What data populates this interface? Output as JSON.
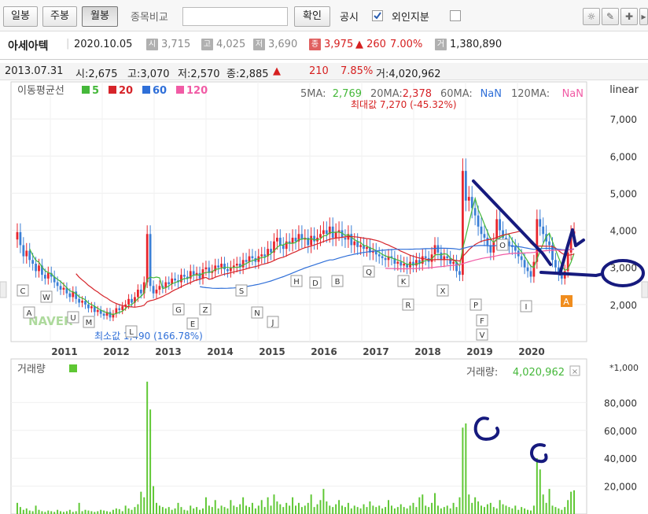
{
  "toolbar": {
    "daily": "일봉",
    "weekly": "주봉",
    "monthly": "월봉",
    "compare_label": "종목비교",
    "compare_value": "",
    "confirm": "확인",
    "disclosure": "공시",
    "foreign": "외인지분",
    "disclosure_checked": true,
    "foreign_checked": false
  },
  "quote": {
    "name": "아세아텍",
    "date": "2020.10.05",
    "open_label": "시",
    "open": "3,715",
    "high_label": "고",
    "high": "4,025",
    "low_label": "저",
    "low": "3,690",
    "close_label": "종",
    "close": "3,975",
    "change": "▲ 260",
    "change_pct": "7.00%",
    "vol_label": "거",
    "volume": "1,380,890"
  },
  "info": {
    "date": "2013.07.31",
    "open": "시:2,675",
    "high": "고:3,070",
    "low": "저:2,570",
    "close": "종:2,885",
    "arrow": "▲",
    "change": "210",
    "change_pct": "7.85%",
    "volume": "거:4,020,962"
  },
  "colors": {
    "up": "#e8242b",
    "down": "#3a7fd6",
    "ma5": "#45b83a",
    "ma20": "#d6242a",
    "ma60": "#2f6fd8",
    "ma120": "#f15ba5",
    "volume": "#5ec733",
    "annotation": "#161a7e"
  },
  "chart_data": {
    "type": "candlestick",
    "scale": "linear",
    "title_label": "이동평균선",
    "ma_legend": [
      {
        "period": "5",
        "color": "#45b83a"
      },
      {
        "period": "20",
        "color": "#d6242a"
      },
      {
        "period": "60",
        "color": "#2f6fd8"
      },
      {
        "period": "120",
        "color": "#f15ba5"
      }
    ],
    "ma_values": [
      {
        "label": "5MA:",
        "value": "2,769",
        "color": "#45b83a"
      },
      {
        "label": "20MA:",
        "value": "2,378",
        "color": "#d6242a"
      },
      {
        "label": "60MA:",
        "value": "NaN",
        "color": "#2f6fd8"
      },
      {
        "label": "120MA:",
        "value": "NaN",
        "color": "#f15ba5"
      }
    ],
    "max_label": "최대값 7,270 (-45.32%)",
    "min_label": "최소값 1,490 (166.78%)",
    "ylim": [
      1000,
      8000
    ],
    "yticks": [
      2000,
      3000,
      4000,
      5000,
      6000,
      7000
    ],
    "ytick_labels": [
      "2,000",
      "3,000",
      "4,000",
      "5,000",
      "6,000",
      "7,000"
    ],
    "xticks": [
      "2011",
      "2012",
      "2013",
      "2014",
      "2015",
      "2016",
      "2017",
      "2018",
      "2019",
      "2020"
    ],
    "closes": [
      3950,
      3600,
      3300,
      3450,
      3200,
      3100,
      2900,
      3050,
      2800,
      2700,
      2850,
      2750,
      2600,
      2500,
      2400,
      2450,
      2300,
      2200,
      2350,
      2150,
      2050,
      2100,
      2000,
      1900,
      1950,
      1800,
      1850,
      1750,
      1700,
      1800,
      1650,
      1750,
      1900,
      1850,
      1950,
      2000,
      2150,
      2050,
      2200,
      2400,
      2300,
      2600,
      3900,
      2500,
      2300,
      2400,
      2500,
      2450,
      2600,
      2550,
      2700,
      2650,
      2600,
      2800,
      2750,
      2700,
      2900,
      2800,
      2850,
      2700,
      2950,
      3000,
      2850,
      2900,
      3050,
      3000,
      3100,
      2950,
      2900,
      3000,
      3050,
      3100,
      3000,
      3200,
      3150,
      3300,
      3250,
      3150,
      3300,
      3350,
      3300,
      3500,
      3400,
      3700,
      3800,
      3600,
      3500,
      3700,
      3650,
      3800,
      3700,
      3900,
      3750,
      3800,
      3600,
      3850,
      3700,
      3800,
      3900,
      4000,
      3900,
      4100,
      3800,
      3950,
      4000,
      3800,
      3750,
      3900,
      3600,
      3700,
      3550,
      3600,
      3500,
      3550,
      3400,
      3450,
      3350,
      3300,
      3250,
      3200,
      3300,
      3250,
      3100,
      3150,
      3050,
      3100,
      3000,
      3150,
      3050,
      3200,
      3100,
      3300,
      3250,
      3150,
      3350,
      3600,
      3400,
      3200,
      3300,
      3250,
      3100,
      3150,
      2900,
      2800,
      5600,
      4800,
      4900,
      4600,
      4400,
      4100,
      3900,
      3800,
      3600,
      3400,
      3700,
      4300,
      4000,
      3800,
      3700,
      3600,
      3550,
      3450,
      3300,
      3200,
      3000,
      2900,
      2750,
      3150,
      4300,
      4100,
      3900,
      3700,
      3600,
      3200,
      3000,
      2800,
      2700,
      2900,
      3400,
      3900,
      3975
    ],
    "volume_ylim": [
      0,
      100000
    ],
    "volume_unit": "*1,000",
    "volume_label": "거래량",
    "volume_value_label": "거래량:",
    "volume_value": "4,020,962",
    "volume_yticks": [
      "20,000",
      "40,000",
      "60,000",
      "80,000"
    ],
    "volume": [
      8000,
      5000,
      3000,
      4000,
      2500,
      2000,
      6000,
      3000,
      2000,
      1500,
      2500,
      2000,
      1500,
      3000,
      2000,
      1500,
      2000,
      3000,
      1500,
      2000,
      8000,
      2000,
      3000,
      2500,
      2000,
      1500,
      2000,
      3000,
      2500,
      2000,
      1500,
      3000,
      4000,
      3500,
      2000,
      6000,
      4000,
      3000,
      5000,
      7000,
      16000,
      12000,
      95000,
      75000,
      20000,
      8000,
      6000,
      5000,
      4000,
      5000,
      3000,
      4000,
      8000,
      5000,
      3000,
      2500,
      6000,
      4000,
      5000,
      3000,
      4000,
      12000,
      6000,
      5000,
      10000,
      4000,
      6000,
      5000,
      4000,
      10000,
      6000,
      5000,
      7000,
      12000,
      6000,
      5000,
      8000,
      4000,
      6000,
      10000,
      5000,
      12000,
      6000,
      14000,
      9000,
      7000,
      5000,
      8000,
      6000,
      12000,
      6000,
      8000,
      5000,
      6000,
      8000,
      14000,
      5000,
      7000,
      10000,
      18000,
      9000,
      6000,
      5000,
      7000,
      10000,
      6000,
      5000,
      8000,
      4000,
      6000,
      5000,
      4000,
      7000,
      5000,
      9000,
      6000,
      5000,
      6000,
      4000,
      5000,
      10000,
      6000,
      4000,
      5000,
      7000,
      5000,
      4000,
      6000,
      8000,
      5000,
      12000,
      14000,
      6000,
      5000,
      8000,
      15000,
      6000,
      4000,
      5000,
      6000,
      4000,
      8000,
      5000,
      12000,
      62000,
      65000,
      14000,
      8000,
      12000,
      9000,
      6000,
      5000,
      7000,
      8000,
      5000,
      4000,
      10000,
      7000,
      6000,
      5000,
      4000,
      6000,
      3000,
      5000,
      4000,
      3000,
      2500,
      6000,
      40000,
      32000,
      14000,
      8000,
      18000,
      6000,
      5000,
      4000,
      3000,
      5000,
      10000,
      16000,
      17000
    ]
  },
  "event_markers": [
    {
      "label": "C"
    },
    {
      "label": "A"
    },
    {
      "label": "W"
    },
    {
      "label": "U"
    },
    {
      "label": "M"
    },
    {
      "label": "L"
    },
    {
      "label": "G"
    },
    {
      "label": "E"
    },
    {
      "label": "Z"
    },
    {
      "label": "S"
    },
    {
      "label": "N"
    },
    {
      "label": "J"
    },
    {
      "label": "H"
    },
    {
      "label": "D"
    },
    {
      "label": "B"
    },
    {
      "label": "Q"
    },
    {
      "label": "K"
    },
    {
      "label": "R"
    },
    {
      "label": "X"
    },
    {
      "label": "F"
    },
    {
      "label": "I"
    },
    {
      "label": "V"
    },
    {
      "label": "O"
    },
    {
      "label": "P"
    }
  ],
  "watermark": "NAVER",
  "annotations": [
    "arrow-down-trend",
    "circle-3000",
    "check-mark",
    "circle-volume-2019",
    "circle-volume-2020"
  ]
}
